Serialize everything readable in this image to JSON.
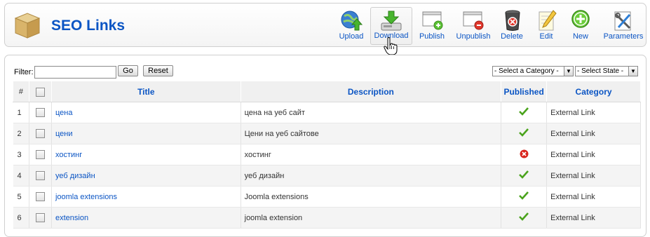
{
  "header": {
    "title": "SEO Links"
  },
  "toolbar": {
    "buttons": [
      {
        "label": "Upload",
        "icon": "upload-icon"
      },
      {
        "label": "Download",
        "icon": "download-icon"
      },
      {
        "label": "Publish",
        "icon": "publish-icon"
      },
      {
        "label": "Unpublish",
        "icon": "unpublish-icon"
      },
      {
        "label": "Delete",
        "icon": "delete-icon"
      },
      {
        "label": "Edit",
        "icon": "edit-icon"
      },
      {
        "label": "New",
        "icon": "new-icon"
      },
      {
        "label": "Parameters",
        "icon": "parameters-icon"
      }
    ]
  },
  "filter": {
    "label": "Filter:",
    "value": "",
    "go_label": "Go",
    "reset_label": "Reset",
    "category_select": "- Select a Category -",
    "state_select": "- Select State -"
  },
  "table": {
    "headers": [
      "#",
      "",
      "Title",
      "Description",
      "Published",
      "Category"
    ],
    "rows": [
      {
        "num": "1",
        "title": "цена",
        "description": "цена на уеб сайт",
        "published": true,
        "category": "External Link"
      },
      {
        "num": "2",
        "title": "цени",
        "description": "Цени на уеб сайтове",
        "published": true,
        "category": "External Link"
      },
      {
        "num": "3",
        "title": "хостинг",
        "description": "хостинг",
        "published": false,
        "category": "External Link"
      },
      {
        "num": "4",
        "title": "уеб дизайн",
        "description": "уеб дизайн",
        "published": true,
        "category": "External Link"
      },
      {
        "num": "5",
        "title": "joomla extensions",
        "description": "Joomla extensions",
        "published": true,
        "category": "External Link"
      },
      {
        "num": "6",
        "title": "extension",
        "description": "joomla extension",
        "published": true,
        "category": "External Link"
      }
    ]
  },
  "colors": {
    "link": "#0b55c4",
    "published": "#4aa31c",
    "unpublished": "#d9251d"
  }
}
